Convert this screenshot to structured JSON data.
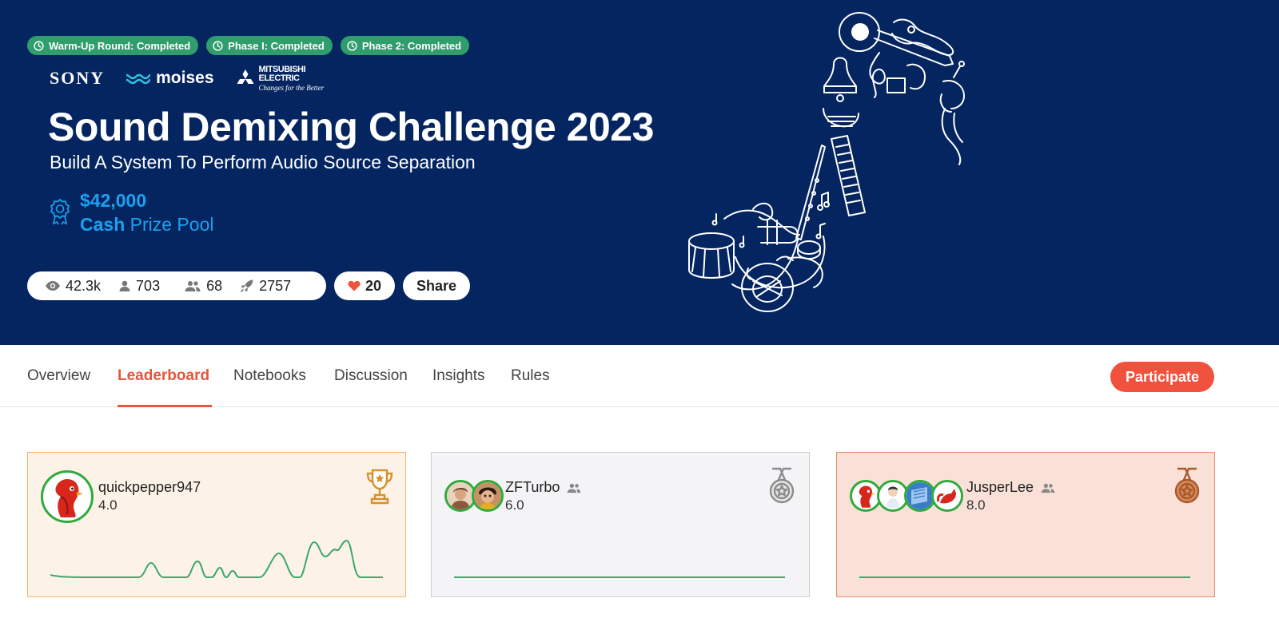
{
  "hero": {
    "badges": [
      {
        "label": "Warm-Up Round: Completed",
        "icon": "clock-icon"
      },
      {
        "label": "Phase I: Completed",
        "icon": "clock-icon"
      },
      {
        "label": "Phase 2: Completed",
        "icon": "clock-icon"
      }
    ],
    "sponsors": {
      "sony": "SONY",
      "moises": "moises",
      "mitsubishi_name_1": "MITSUBISHI",
      "mitsubishi_name_2": "ELECTRIC",
      "mitsubishi_tagline": "Changes for the Better"
    },
    "title": "Sound Demixing Challenge 2023",
    "subtitle": "Build A System To Perform Audio Source Separation",
    "prize": {
      "amount": "$42,000",
      "label_bold": "Cash",
      "label_rest": "Prize Pool",
      "icon": "award-ribbon-icon"
    },
    "stats": {
      "views": "42.3k",
      "participants": "703",
      "teams": "68",
      "submissions": "2757"
    },
    "likes": "20",
    "share_label": "Share",
    "background_color": "#04255f"
  },
  "nav": {
    "tabs": [
      "Overview",
      "Leaderboard",
      "Notebooks",
      "Discussion",
      "Insights",
      "Rules"
    ],
    "active_tab": "Leaderboard",
    "participate_label": "Participate",
    "accent_color": "#e4573d"
  },
  "leaderboard": [
    {
      "rank": 1,
      "name": "quickpepper947",
      "score": "4.0",
      "is_team": false,
      "medal": "gold-trophy-icon"
    },
    {
      "rank": 2,
      "name": "ZFTurbo",
      "score": "6.0",
      "is_team": true,
      "medal": "silver-medal-icon"
    },
    {
      "rank": 3,
      "name": "JusperLee",
      "score": "8.0",
      "is_team": true,
      "medal": "bronze-medal-icon"
    }
  ]
}
